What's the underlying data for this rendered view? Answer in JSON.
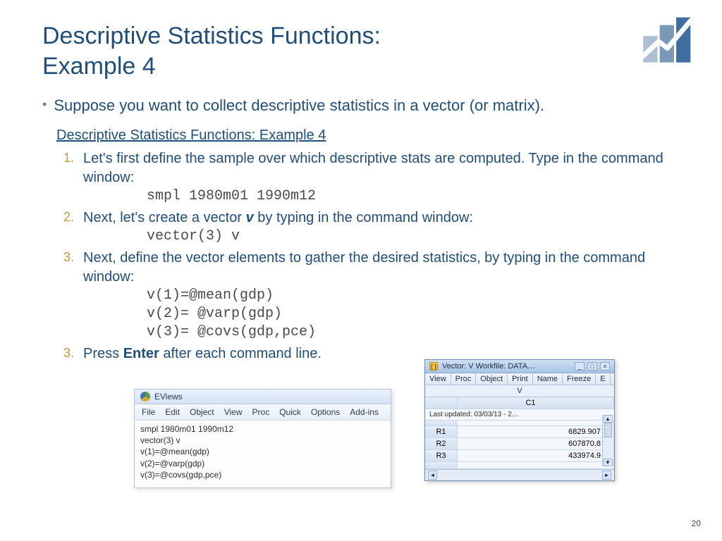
{
  "title_line1": "Descriptive Statistics Functions:",
  "title_line2": "Example 4",
  "intro": "Suppose you want to collect descriptive statistics in a vector (or matrix).",
  "subhead": "Descriptive Statistics Functions: Example 4",
  "steps": {
    "s1": {
      "num": "1.",
      "text_a": "Let's first define the sample over which descriptive stats are computed. Type in the command window:",
      "code": "smpl 1980m01 1990m12"
    },
    "s2": {
      "num": "2.",
      "text_a": "Next, let's create a vector ",
      "vec": "v",
      "text_b": " by typing in the command window:",
      "code": "vector(3) v"
    },
    "s3": {
      "num": "3.",
      "text_a": "Next, define the vector elements to gather the desired statistics, by typing in the command window:",
      "code1": "v(1)=@mean(gdp)",
      "code2": "v(2)= @varp(gdp)",
      "code3": "v(3)= @covs(gdp,pce)"
    },
    "s4": {
      "num": "3.",
      "text_a": "Press ",
      "enter": "Enter",
      "text_b": " after each command line."
    }
  },
  "eviews": {
    "title": "EViews",
    "menu": [
      "File",
      "Edit",
      "Object",
      "View",
      "Proc",
      "Quick",
      "Options",
      "Add-ins"
    ],
    "lines": [
      "smpl 1980m01 1990m12",
      "vector(3) v",
      "v(1)=@mean(gdp)",
      "v(2)=@varp(gdp)",
      "v(3)=@covs(gdp,pce)"
    ]
  },
  "vector_win": {
    "title": "Vector: V   Workfile: DATA…",
    "toolbar": [
      "View",
      "Proc",
      "Object",
      "Print",
      "Name",
      "Freeze",
      "E"
    ],
    "name": "V",
    "col": "C1",
    "last_updated": "Last updated: 03/03/13 - 2…",
    "rows": [
      {
        "label": "R1",
        "value": "6829.907"
      },
      {
        "label": "R2",
        "value": "607870.8"
      },
      {
        "label": "R3",
        "value": "433974.9"
      }
    ]
  },
  "page_number": "20"
}
